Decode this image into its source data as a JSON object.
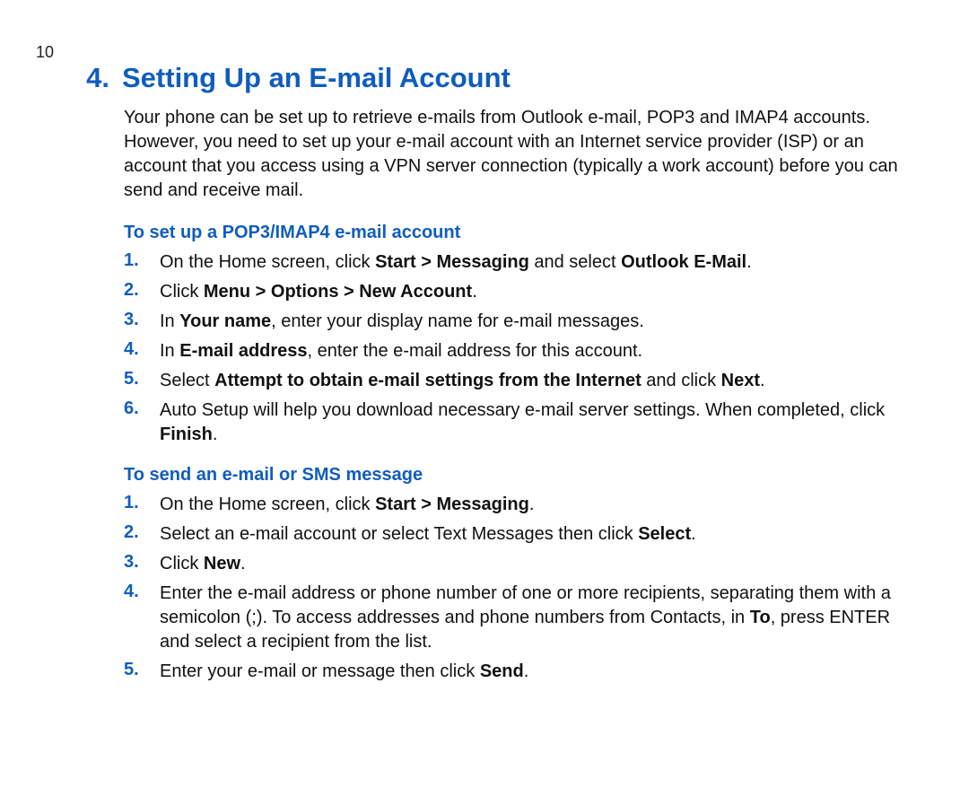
{
  "page_number": "10",
  "section_number": "4.",
  "section_title": "Setting Up an E-mail Account",
  "intro": "Your phone can be set up to retrieve e-mails from Outlook e-mail, POP3 and IMAP4 accounts. However, you need to set up your e-mail account with an Internet service provider (ISP) or an account that you access using a VPN server connection (typically a work account) before you can send and receive mail.",
  "sub1_title": "To set up a POP3/IMAP4 e-mail account",
  "sub1_steps": [
    {
      "n": "1.",
      "pre": "On the Home screen, click ",
      "b1": "Start > Messaging",
      "mid": " and select ",
      "b2": "Outlook E-Mail",
      "post": "."
    },
    {
      "n": "2.",
      "pre": "Click ",
      "b1": "Menu > Options > New Account",
      "mid": "",
      "b2": "",
      "post": "."
    },
    {
      "n": "3.",
      "pre": "In ",
      "b1": "Your name",
      "mid": ", enter your display name for e-mail messages.",
      "b2": "",
      "post": ""
    },
    {
      "n": "4.",
      "pre": "In ",
      "b1": "E-mail address",
      "mid": ", enter the e-mail address for this account.",
      "b2": "",
      "post": ""
    },
    {
      "n": "5.",
      "pre": "Select ",
      "b1": "Attempt to obtain e-mail settings from the Internet",
      "mid": " and click ",
      "b2": "Next",
      "post": "."
    },
    {
      "n": "6.",
      "pre": "Auto Setup will help you download necessary e-mail server settings. When completed, click ",
      "b1": "Finish",
      "mid": "",
      "b2": "",
      "post": "."
    }
  ],
  "sub2_title": "To send an e-mail or SMS message",
  "sub2_steps": [
    {
      "n": "1.",
      "pre": "On the Home screen, click ",
      "b1": "Start > Messaging",
      "mid": "",
      "b2": "",
      "post": "."
    },
    {
      "n": "2.",
      "pre": "Select an e-mail account or select Text Messages then click ",
      "b1": "Select",
      "mid": "",
      "b2": "",
      "post": "."
    },
    {
      "n": "3.",
      "pre": "Click ",
      "b1": "New",
      "mid": "",
      "b2": "",
      "post": "."
    },
    {
      "n": "4.",
      "pre": "Enter the e-mail address or phone number of one or more recipients, separating them with a semicolon (;). To access addresses and phone numbers from Contacts, in ",
      "b1": "To",
      "mid": ", press ENTER and select a recipient from the list.",
      "b2": "",
      "post": ""
    },
    {
      "n": "5.",
      "pre": "Enter your e-mail or message then click ",
      "b1": "Send",
      "mid": "",
      "b2": "",
      "post": "."
    }
  ]
}
